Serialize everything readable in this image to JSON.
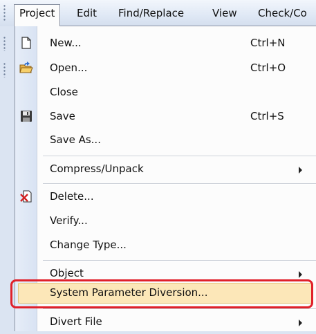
{
  "menubar": {
    "items": [
      {
        "label": "Project"
      },
      {
        "label": "Edit"
      },
      {
        "label": "Find/Replace"
      },
      {
        "label": "View"
      },
      {
        "label": "Check/Co"
      }
    ]
  },
  "project_menu": {
    "items": [
      {
        "label": "New...",
        "shortcut": "Ctrl+N",
        "icon": "new-file-icon"
      },
      {
        "label": "Open...",
        "shortcut": "Ctrl+O",
        "icon": "open-folder-icon"
      },
      {
        "label": "Close"
      },
      {
        "label": "Save",
        "shortcut": "Ctrl+S",
        "icon": "save-disk-icon"
      },
      {
        "label": "Save As..."
      },
      {
        "label": "Compress/Unpack",
        "submenu": true
      },
      {
        "label": "Delete...",
        "icon": "delete-icon"
      },
      {
        "label": "Verify..."
      },
      {
        "label": "Change Type..."
      },
      {
        "label": "Object",
        "submenu": true
      },
      {
        "label": "System Parameter Diversion...",
        "highlighted": true
      },
      {
        "label": "Divert File",
        "submenu": true
      }
    ]
  },
  "colors": {
    "highlight_fill": "#fce7b8",
    "annotation_red": "#e0202a"
  }
}
